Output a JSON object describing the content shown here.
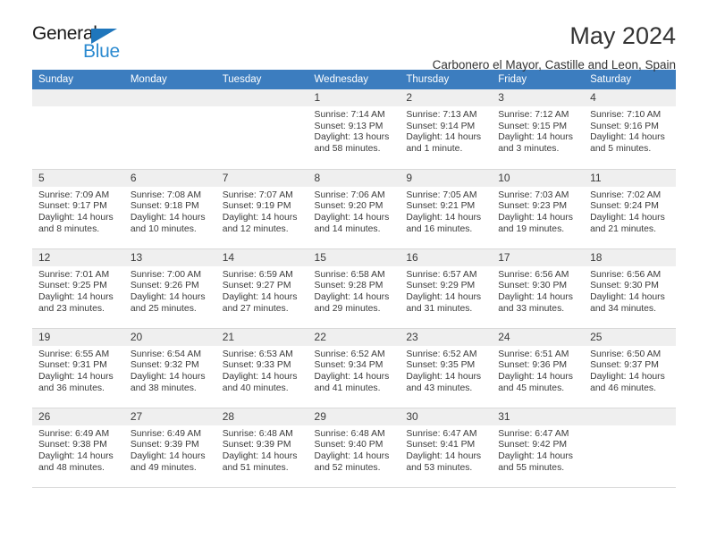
{
  "brand": {
    "name_top": "General",
    "name_bottom": "Blue",
    "triangle_color": "#1f76bc",
    "blue_text_color": "#2b8ad0"
  },
  "header": {
    "title": "May 2024",
    "subtitle": "Carbonero el Mayor, Castille and Leon, Spain"
  },
  "theme": {
    "header_row_bg": "#3c7dbf",
    "header_row_text": "#ffffff",
    "daynum_bg": "#efefef",
    "cell_border": "#d9d9d9",
    "text": "#3b3b3b"
  },
  "weekdays": [
    "Sunday",
    "Monday",
    "Tuesday",
    "Wednesday",
    "Thursday",
    "Friday",
    "Saturday"
  ],
  "weeks": [
    [
      {
        "day": "",
        "sunrise": "",
        "sunset": "",
        "daylight": "",
        "blank": true
      },
      {
        "day": "",
        "sunrise": "",
        "sunset": "",
        "daylight": "",
        "blank": true
      },
      {
        "day": "",
        "sunrise": "",
        "sunset": "",
        "daylight": "",
        "blank": true
      },
      {
        "day": "1",
        "sunrise": "Sunrise: 7:14 AM",
        "sunset": "Sunset: 9:13 PM",
        "daylight": "Daylight: 13 hours and 58 minutes."
      },
      {
        "day": "2",
        "sunrise": "Sunrise: 7:13 AM",
        "sunset": "Sunset: 9:14 PM",
        "daylight": "Daylight: 14 hours and 1 minute."
      },
      {
        "day": "3",
        "sunrise": "Sunrise: 7:12 AM",
        "sunset": "Sunset: 9:15 PM",
        "daylight": "Daylight: 14 hours and 3 minutes."
      },
      {
        "day": "4",
        "sunrise": "Sunrise: 7:10 AM",
        "sunset": "Sunset: 9:16 PM",
        "daylight": "Daylight: 14 hours and 5 minutes."
      }
    ],
    [
      {
        "day": "5",
        "sunrise": "Sunrise: 7:09 AM",
        "sunset": "Sunset: 9:17 PM",
        "daylight": "Daylight: 14 hours and 8 minutes."
      },
      {
        "day": "6",
        "sunrise": "Sunrise: 7:08 AM",
        "sunset": "Sunset: 9:18 PM",
        "daylight": "Daylight: 14 hours and 10 minutes."
      },
      {
        "day": "7",
        "sunrise": "Sunrise: 7:07 AM",
        "sunset": "Sunset: 9:19 PM",
        "daylight": "Daylight: 14 hours and 12 minutes."
      },
      {
        "day": "8",
        "sunrise": "Sunrise: 7:06 AM",
        "sunset": "Sunset: 9:20 PM",
        "daylight": "Daylight: 14 hours and 14 minutes."
      },
      {
        "day": "9",
        "sunrise": "Sunrise: 7:05 AM",
        "sunset": "Sunset: 9:21 PM",
        "daylight": "Daylight: 14 hours and 16 minutes."
      },
      {
        "day": "10",
        "sunrise": "Sunrise: 7:03 AM",
        "sunset": "Sunset: 9:23 PM",
        "daylight": "Daylight: 14 hours and 19 minutes."
      },
      {
        "day": "11",
        "sunrise": "Sunrise: 7:02 AM",
        "sunset": "Sunset: 9:24 PM",
        "daylight": "Daylight: 14 hours and 21 minutes."
      }
    ],
    [
      {
        "day": "12",
        "sunrise": "Sunrise: 7:01 AM",
        "sunset": "Sunset: 9:25 PM",
        "daylight": "Daylight: 14 hours and 23 minutes."
      },
      {
        "day": "13",
        "sunrise": "Sunrise: 7:00 AM",
        "sunset": "Sunset: 9:26 PM",
        "daylight": "Daylight: 14 hours and 25 minutes."
      },
      {
        "day": "14",
        "sunrise": "Sunrise: 6:59 AM",
        "sunset": "Sunset: 9:27 PM",
        "daylight": "Daylight: 14 hours and 27 minutes."
      },
      {
        "day": "15",
        "sunrise": "Sunrise: 6:58 AM",
        "sunset": "Sunset: 9:28 PM",
        "daylight": "Daylight: 14 hours and 29 minutes."
      },
      {
        "day": "16",
        "sunrise": "Sunrise: 6:57 AM",
        "sunset": "Sunset: 9:29 PM",
        "daylight": "Daylight: 14 hours and 31 minutes."
      },
      {
        "day": "17",
        "sunrise": "Sunrise: 6:56 AM",
        "sunset": "Sunset: 9:30 PM",
        "daylight": "Daylight: 14 hours and 33 minutes."
      },
      {
        "day": "18",
        "sunrise": "Sunrise: 6:56 AM",
        "sunset": "Sunset: 9:30 PM",
        "daylight": "Daylight: 14 hours and 34 minutes."
      }
    ],
    [
      {
        "day": "19",
        "sunrise": "Sunrise: 6:55 AM",
        "sunset": "Sunset: 9:31 PM",
        "daylight": "Daylight: 14 hours and 36 minutes."
      },
      {
        "day": "20",
        "sunrise": "Sunrise: 6:54 AM",
        "sunset": "Sunset: 9:32 PM",
        "daylight": "Daylight: 14 hours and 38 minutes."
      },
      {
        "day": "21",
        "sunrise": "Sunrise: 6:53 AM",
        "sunset": "Sunset: 9:33 PM",
        "daylight": "Daylight: 14 hours and 40 minutes."
      },
      {
        "day": "22",
        "sunrise": "Sunrise: 6:52 AM",
        "sunset": "Sunset: 9:34 PM",
        "daylight": "Daylight: 14 hours and 41 minutes."
      },
      {
        "day": "23",
        "sunrise": "Sunrise: 6:52 AM",
        "sunset": "Sunset: 9:35 PM",
        "daylight": "Daylight: 14 hours and 43 minutes."
      },
      {
        "day": "24",
        "sunrise": "Sunrise: 6:51 AM",
        "sunset": "Sunset: 9:36 PM",
        "daylight": "Daylight: 14 hours and 45 minutes."
      },
      {
        "day": "25",
        "sunrise": "Sunrise: 6:50 AM",
        "sunset": "Sunset: 9:37 PM",
        "daylight": "Daylight: 14 hours and 46 minutes."
      }
    ],
    [
      {
        "day": "26",
        "sunrise": "Sunrise: 6:49 AM",
        "sunset": "Sunset: 9:38 PM",
        "daylight": "Daylight: 14 hours and 48 minutes."
      },
      {
        "day": "27",
        "sunrise": "Sunrise: 6:49 AM",
        "sunset": "Sunset: 9:39 PM",
        "daylight": "Daylight: 14 hours and 49 minutes."
      },
      {
        "day": "28",
        "sunrise": "Sunrise: 6:48 AM",
        "sunset": "Sunset: 9:39 PM",
        "daylight": "Daylight: 14 hours and 51 minutes."
      },
      {
        "day": "29",
        "sunrise": "Sunrise: 6:48 AM",
        "sunset": "Sunset: 9:40 PM",
        "daylight": "Daylight: 14 hours and 52 minutes."
      },
      {
        "day": "30",
        "sunrise": "Sunrise: 6:47 AM",
        "sunset": "Sunset: 9:41 PM",
        "daylight": "Daylight: 14 hours and 53 minutes."
      },
      {
        "day": "31",
        "sunrise": "Sunrise: 6:47 AM",
        "sunset": "Sunset: 9:42 PM",
        "daylight": "Daylight: 14 hours and 55 minutes."
      },
      {
        "day": "",
        "sunrise": "",
        "sunset": "",
        "daylight": "",
        "blank": true
      }
    ]
  ]
}
